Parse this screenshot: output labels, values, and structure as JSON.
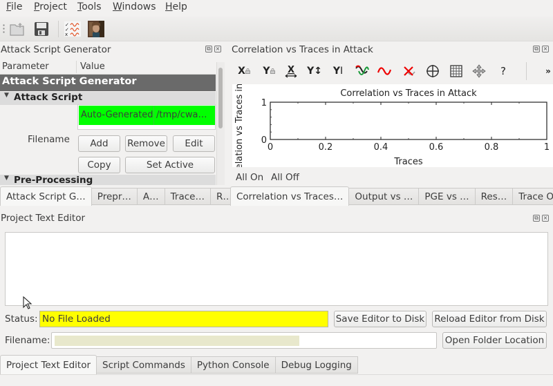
{
  "menubar": {
    "items": [
      {
        "label": "File",
        "mnemonic": "F",
        "rest": "ile"
      },
      {
        "label": "Project",
        "mnemonic": "P",
        "rest": "roject"
      },
      {
        "label": "Tools",
        "mnemonic": "T",
        "rest": "ools"
      },
      {
        "label": "Windows",
        "mnemonic": "W",
        "rest": "indows"
      },
      {
        "label": "Help",
        "mnemonic": "H",
        "rest": "elp"
      }
    ]
  },
  "toolbar": {
    "buttons": [
      {
        "icon": "open-folder-icon",
        "tooltip": "Open"
      },
      {
        "icon": "save-icon",
        "tooltip": "Save"
      },
      {
        "icon": "trace-manager-icon",
        "tooltip": "Trace Management"
      },
      {
        "icon": "avatar-image-icon",
        "tooltip": "Image"
      }
    ]
  },
  "left_dock": {
    "title": "Attack Script Generator",
    "tree": {
      "col_parameter": "Parameter",
      "col_value": "Value",
      "group": "Attack Script Generator",
      "subgroup1": "Attack Script",
      "subgroup2": "Pre-Processing",
      "file_list": {
        "name": "Auto-Generated",
        "path": "/tmp/cwa…"
      },
      "filename_label": "Filename",
      "buttons": {
        "add": "Add",
        "remove": "Remove",
        "edit": "Edit",
        "copy": "Copy",
        "set_active": "Set Active"
      }
    },
    "tabs": [
      "Attack Script G…",
      "Prepr…",
      "A…",
      "Trace…",
      "R…"
    ],
    "active_tab": 0
  },
  "right_dock": {
    "title": "Correlation vs Traces in Attack",
    "plot_tools": [
      {
        "icon": "x-lock-icon",
        "label": "X"
      },
      {
        "icon": "y-lock-icon",
        "label": "Y"
      },
      {
        "icon": "x-autorange-icon",
        "label": "X"
      },
      {
        "icon": "y-autorange-icon",
        "label": "Y"
      },
      {
        "icon": "y-default-icon",
        "label": "Y"
      },
      {
        "icon": "show-traces-icon",
        "label": ""
      },
      {
        "icon": "single-trace-icon",
        "label": ""
      },
      {
        "icon": "clear-traces-icon",
        "label": ""
      },
      {
        "icon": "crosshair-icon",
        "label": ""
      },
      {
        "icon": "grid-icon",
        "label": ""
      },
      {
        "icon": "pan-icon",
        "label": ""
      },
      {
        "icon": "help-icon",
        "label": "?"
      },
      {
        "icon": "overflow-icon",
        "label": "»"
      }
    ],
    "all_on": "All On",
    "all_off": "All Off",
    "tabs": [
      "Correlation vs Traces…",
      "Output vs …",
      "PGE vs …",
      "Res…",
      "Trace O…"
    ],
    "active_tab": 0
  },
  "chart_data": {
    "type": "line",
    "title": "Correlation vs Traces in Attack",
    "xlabel": "Traces",
    "ylabel": "Correlation vs Traces in Attack",
    "ylabel_visible": "elation vs Traces in",
    "xlim": [
      0,
      1
    ],
    "ylim": [
      0,
      1
    ],
    "x_ticks": [
      "0",
      "0.2",
      "0.4",
      "0.6",
      "0.8",
      "1"
    ],
    "y_ticks": [
      "0",
      "1"
    ],
    "series": [],
    "grid": false
  },
  "bottom_dock": {
    "title": "Project Text Editor",
    "editor_content": "",
    "status_label": "Status:",
    "status_value": "No File Loaded",
    "status_color": "#ffff00",
    "filename_label": "Filename:",
    "filename_value": "",
    "buttons": {
      "save": "Save Editor to Disk",
      "reload": "Reload Editor from Disk",
      "open_folder": "Open Folder Location"
    },
    "tabs": [
      "Project Text Editor",
      "Script Commands",
      "Python Console",
      "Debug Logging"
    ],
    "active_tab": 0
  }
}
